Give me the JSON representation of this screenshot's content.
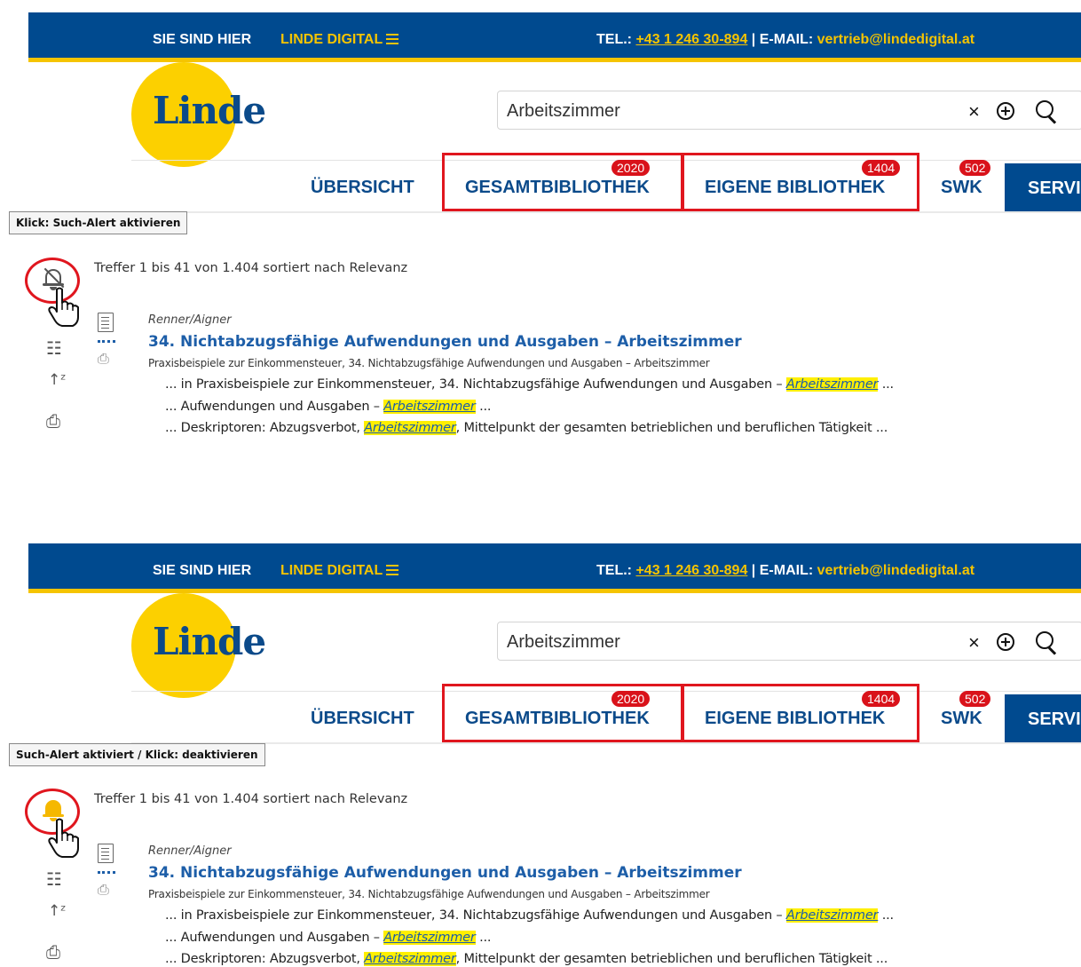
{
  "header": {
    "here_label": "SIE SIND HIER",
    "site_label": "LINDE DIGITAL",
    "phone_prefix": "TEL.:",
    "phone": "+43 1 246 30-894",
    "separator": "|",
    "email_prefix": "E-MAIL:",
    "email": "vertrieb@lindedigital.at"
  },
  "logo": {
    "text": "Linde"
  },
  "search": {
    "value": "Arbeitszimmer",
    "clear": "×"
  },
  "nav": {
    "overview": "ÜBERSICHT",
    "gesamt": "GESAMTBIBLIOTHEK",
    "gesamt_count": "2020",
    "eigene": "EIGENE BIBLIOTHEK",
    "eigene_count": "1404",
    "swk": "SWK",
    "swk_count": "502",
    "service": "SERVI"
  },
  "panels": [
    {
      "tooltip": "Klick: Such-Alert aktivieren",
      "alert_state": "off"
    },
    {
      "tooltip": "Such-Alert aktiviert / Klick: deaktivieren",
      "alert_state": "on"
    }
  ],
  "results": {
    "count_text": "Treffer 1 bis 41 von 1.404 sortiert nach Relevanz",
    "item": {
      "author": "Renner/Aigner",
      "title": "34. Nichtabzugsfähige Aufwendungen und Ausgaben – Arbeitszimmer",
      "source": "Praxisbeispiele zur Einkommensteuer, 34. Nichtabzugsfähige Aufwendungen und Ausgaben – Arbeitszimmer",
      "snippet1_pre": "... in Praxisbeispiele zur Einkommensteuer, 34. Nichtabzugsfähige Aufwendungen und Ausgaben – ",
      "snippet1_hl": "Arbeitszimmer",
      "snippet1_post": " ...",
      "snippet2_pre": "... Aufwendungen und Ausgaben – ",
      "snippet2_hl": "Arbeitszimmer",
      "snippet2_post": " ...",
      "snippet3_pre": "... Deskriptoren: Abzugsverbot, ",
      "snippet3_hl": "Arbeitszimmer",
      "snippet3_post": ", Mittelpunkt der gesamten betrieblichen und beruflichen Tätigkeit ..."
    }
  },
  "colors": {
    "brand_blue": "#004a8f",
    "brand_yellow": "#f5c400",
    "highlight_red": "#e0161e",
    "badge_red": "#d9121a",
    "link_blue": "#1d5ea8",
    "bell_active": "#f5b800"
  },
  "icons": [
    "menu-icon",
    "clear-icon",
    "add-circle-icon",
    "search-icon",
    "bell-off-icon",
    "bell-icon",
    "hand-cursor-icon",
    "checklist-icon",
    "sort-icon",
    "print-icon",
    "document-icon"
  ]
}
